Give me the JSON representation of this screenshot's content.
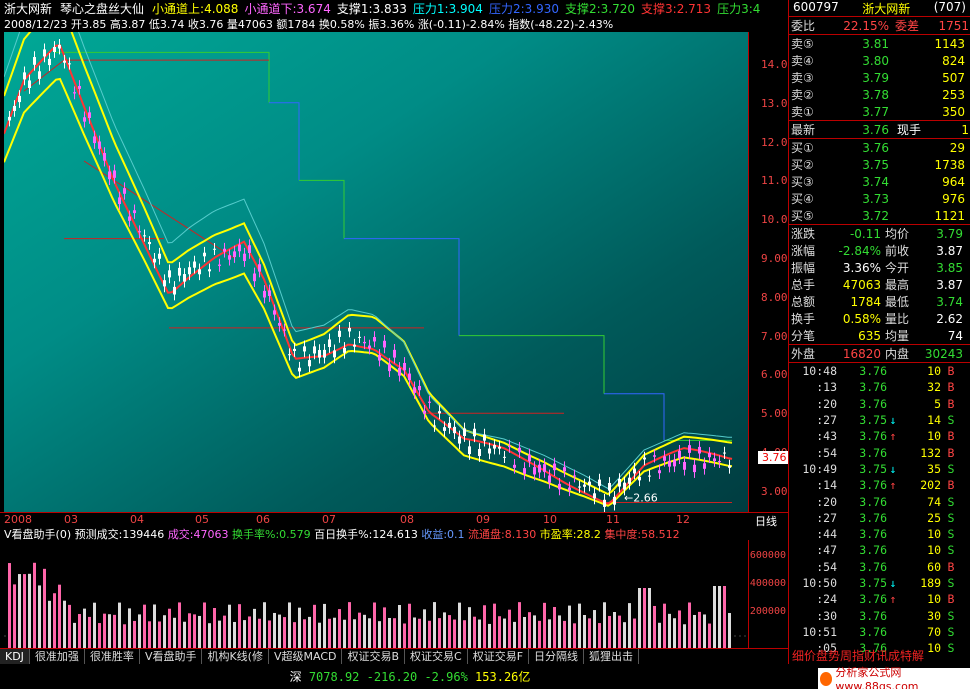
{
  "title_bar": {
    "stock_name": "浙大网新",
    "indicator": "琴心之盘丝大仙",
    "items": [
      {
        "label": "小通道上:4.088",
        "color": "#ffff00"
      },
      {
        "label": "小通道下:3.674",
        "color": "#ff66ff"
      },
      {
        "label": "支撑1:3.833",
        "color": "#ffffff"
      },
      {
        "label": "压力1:3.904",
        "color": "#00ffff"
      },
      {
        "label": "压力2:3.930",
        "color": "#3366ff"
      },
      {
        "label": "支撑2:3.720",
        "color": "#33dd33"
      },
      {
        "label": "支撑3:2.713",
        "color": "#ff3333"
      },
      {
        "label": "压力3:4",
        "color": "#33dd33"
      }
    ]
  },
  "ohlc": {
    "date": "2008/12/23",
    "open": "开3.85",
    "high": "高3.87",
    "low": "低3.74",
    "close": "收3.76",
    "vol": "量47063",
    "amount": "额1784",
    "turnover": "换0.58%",
    "amplitude": "振3.36%",
    "change": "涨(-0.11)-2.84%",
    "index": "指数(-48.22)-2.43%"
  },
  "price_axis": [
    "14.00",
    "13.00",
    "12.00",
    "11.00",
    "10.00",
    "9.00",
    "8.00",
    "7.00",
    "6.00",
    "5.00",
    "4.00",
    "3.00"
  ],
  "current_price": "3.76",
  "low_label": "2.66",
  "date_axis": [
    "2008",
    "03",
    "04",
    "05",
    "06",
    "07",
    "08",
    "09",
    "10",
    "11",
    "12"
  ],
  "date_axis_mode": "日线",
  "vol_title": {
    "name": "V看盘助手(0)",
    "pred": "预测成交:139446",
    "vol": "成交:47063",
    "turn": "换手率%:0.579",
    "turn100": "百日换手%:124.613",
    "profit": "收益:0.1",
    "float": "流通盘:8.130",
    "pe": "市盈率:28.2",
    "conc": "集中度:58.512"
  },
  "vol_axis": [
    "600000",
    "400000",
    "200000"
  ],
  "tabs": [
    "KDJ",
    "很准加强",
    "很准胜率",
    "V看盘助手",
    "机构K线(修",
    "V超级MACD",
    "权证交易B",
    "权证交易C",
    "权证交易F",
    "日分隔线",
    "狐狸出击"
  ],
  "status": {
    "market": "深",
    "index": "7078.92",
    "change": "-216.20",
    "pct": "-2.96%",
    "amount": "153.26亿"
  },
  "sidebar": {
    "code": "600797",
    "name": "浙大网新",
    "flag": "(707)",
    "weibi": {
      "label": "委比",
      "value": "22.15%",
      "label2": "委差",
      "value2": "1751"
    },
    "sells": [
      {
        "label": "卖⑤",
        "price": "3.81",
        "vol": "1143"
      },
      {
        "label": "卖④",
        "price": "3.80",
        "vol": "824"
      },
      {
        "label": "卖③",
        "price": "3.79",
        "vol": "507"
      },
      {
        "label": "卖②",
        "price": "3.78",
        "vol": "253"
      },
      {
        "label": "卖①",
        "price": "3.77",
        "vol": "350"
      }
    ],
    "latest": {
      "label": "最新",
      "price": "3.76",
      "label2": "现手",
      "vol": "1"
    },
    "buys": [
      {
        "label": "买①",
        "price": "3.76",
        "vol": "29"
      },
      {
        "label": "买②",
        "price": "3.75",
        "vol": "1738"
      },
      {
        "label": "买③",
        "price": "3.74",
        "vol": "964"
      },
      {
        "label": "买④",
        "price": "3.73",
        "vol": "976"
      },
      {
        "label": "买⑤",
        "price": "3.72",
        "vol": "1121"
      }
    ],
    "stats": [
      {
        "k": "涨跌",
        "v": "-0.11",
        "k2": "均价",
        "v2": "3.79"
      },
      {
        "k": "涨幅",
        "v": "-2.84%",
        "k2": "前收",
        "v2": "3.87"
      },
      {
        "k": "振幅",
        "v": "3.36%",
        "k2": "今开",
        "v2": "3.85"
      },
      {
        "k": "总手",
        "v": "47063",
        "k2": "最高",
        "v2": "3.87"
      },
      {
        "k": "总额",
        "v": "1784",
        "k2": "最低",
        "v2": "3.74"
      },
      {
        "k": "换手",
        "v": "0.58%",
        "k2": "量比",
        "v2": "2.62"
      },
      {
        "k": "分笔",
        "v": "635",
        "k2": "均量",
        "v2": "74"
      }
    ],
    "outer": {
      "label": "外盘",
      "value": "16820",
      "label2": "内盘",
      "value2": "30243"
    },
    "ticks": [
      {
        "t": "10:48",
        "p": "3.76",
        "a": "",
        "q": "10",
        "s": "B"
      },
      {
        "t": ":13",
        "p": "3.76",
        "a": "",
        "q": "32",
        "s": "B"
      },
      {
        "t": ":20",
        "p": "3.76",
        "a": "",
        "q": "5",
        "s": "B"
      },
      {
        "t": ":27",
        "p": "3.75",
        "a": "↓",
        "q": "14",
        "s": "S"
      },
      {
        "t": ":43",
        "p": "3.76",
        "a": "↑",
        "q": "10",
        "s": "B"
      },
      {
        "t": ":54",
        "p": "3.76",
        "a": "",
        "q": "132",
        "s": "B"
      },
      {
        "t": "10:49",
        "p": "3.75",
        "a": "↓",
        "q": "35",
        "s": "S"
      },
      {
        "t": ":14",
        "p": "3.76",
        "a": "↑",
        "q": "202",
        "s": "B"
      },
      {
        "t": ":20",
        "p": "3.76",
        "a": "",
        "q": "74",
        "s": "S"
      },
      {
        "t": ":27",
        "p": "3.76",
        "a": "",
        "q": "25",
        "s": "S"
      },
      {
        "t": ":44",
        "p": "3.76",
        "a": "",
        "q": "10",
        "s": "S"
      },
      {
        "t": ":47",
        "p": "3.76",
        "a": "",
        "q": "10",
        "s": "S"
      },
      {
        "t": ":54",
        "p": "3.76",
        "a": "",
        "q": "60",
        "s": "B"
      },
      {
        "t": "10:50",
        "p": "3.75",
        "a": "↓",
        "q": "189",
        "s": "S"
      },
      {
        "t": ":24",
        "p": "3.76",
        "a": "↑",
        "q": "10",
        "s": "B"
      },
      {
        "t": ":30",
        "p": "3.76",
        "a": "",
        "q": "30",
        "s": "S"
      },
      {
        "t": "10:51",
        "p": "3.76",
        "a": "",
        "q": "70",
        "s": "S"
      },
      {
        "t": ":05",
        "p": "3.76",
        "a": "",
        "q": "10",
        "s": "S"
      }
    ],
    "promo": "细价盘势周指财讯成特解"
  },
  "footer_logo": "分析家公式网 www.88gs.com"
}
